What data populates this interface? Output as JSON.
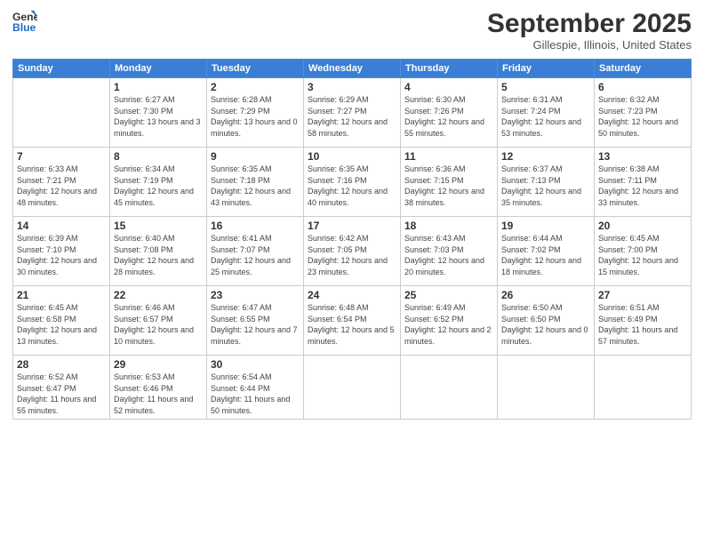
{
  "logo": {
    "line1": "General",
    "line2": "Blue"
  },
  "title": "September 2025",
  "subtitle": "Gillespie, Illinois, United States",
  "weekdays": [
    "Sunday",
    "Monday",
    "Tuesday",
    "Wednesday",
    "Thursday",
    "Friday",
    "Saturday"
  ],
  "weeks": [
    [
      {
        "day": "",
        "sunrise": "",
        "sunset": "",
        "daylight": ""
      },
      {
        "day": "1",
        "sunrise": "Sunrise: 6:27 AM",
        "sunset": "Sunset: 7:30 PM",
        "daylight": "Daylight: 13 hours and 3 minutes."
      },
      {
        "day": "2",
        "sunrise": "Sunrise: 6:28 AM",
        "sunset": "Sunset: 7:29 PM",
        "daylight": "Daylight: 13 hours and 0 minutes."
      },
      {
        "day": "3",
        "sunrise": "Sunrise: 6:29 AM",
        "sunset": "Sunset: 7:27 PM",
        "daylight": "Daylight: 12 hours and 58 minutes."
      },
      {
        "day": "4",
        "sunrise": "Sunrise: 6:30 AM",
        "sunset": "Sunset: 7:26 PM",
        "daylight": "Daylight: 12 hours and 55 minutes."
      },
      {
        "day": "5",
        "sunrise": "Sunrise: 6:31 AM",
        "sunset": "Sunset: 7:24 PM",
        "daylight": "Daylight: 12 hours and 53 minutes."
      },
      {
        "day": "6",
        "sunrise": "Sunrise: 6:32 AM",
        "sunset": "Sunset: 7:23 PM",
        "daylight": "Daylight: 12 hours and 50 minutes."
      }
    ],
    [
      {
        "day": "7",
        "sunrise": "Sunrise: 6:33 AM",
        "sunset": "Sunset: 7:21 PM",
        "daylight": "Daylight: 12 hours and 48 minutes."
      },
      {
        "day": "8",
        "sunrise": "Sunrise: 6:34 AM",
        "sunset": "Sunset: 7:19 PM",
        "daylight": "Daylight: 12 hours and 45 minutes."
      },
      {
        "day": "9",
        "sunrise": "Sunrise: 6:35 AM",
        "sunset": "Sunset: 7:18 PM",
        "daylight": "Daylight: 12 hours and 43 minutes."
      },
      {
        "day": "10",
        "sunrise": "Sunrise: 6:35 AM",
        "sunset": "Sunset: 7:16 PM",
        "daylight": "Daylight: 12 hours and 40 minutes."
      },
      {
        "day": "11",
        "sunrise": "Sunrise: 6:36 AM",
        "sunset": "Sunset: 7:15 PM",
        "daylight": "Daylight: 12 hours and 38 minutes."
      },
      {
        "day": "12",
        "sunrise": "Sunrise: 6:37 AM",
        "sunset": "Sunset: 7:13 PM",
        "daylight": "Daylight: 12 hours and 35 minutes."
      },
      {
        "day": "13",
        "sunrise": "Sunrise: 6:38 AM",
        "sunset": "Sunset: 7:11 PM",
        "daylight": "Daylight: 12 hours and 33 minutes."
      }
    ],
    [
      {
        "day": "14",
        "sunrise": "Sunrise: 6:39 AM",
        "sunset": "Sunset: 7:10 PM",
        "daylight": "Daylight: 12 hours and 30 minutes."
      },
      {
        "day": "15",
        "sunrise": "Sunrise: 6:40 AM",
        "sunset": "Sunset: 7:08 PM",
        "daylight": "Daylight: 12 hours and 28 minutes."
      },
      {
        "day": "16",
        "sunrise": "Sunrise: 6:41 AM",
        "sunset": "Sunset: 7:07 PM",
        "daylight": "Daylight: 12 hours and 25 minutes."
      },
      {
        "day": "17",
        "sunrise": "Sunrise: 6:42 AM",
        "sunset": "Sunset: 7:05 PM",
        "daylight": "Daylight: 12 hours and 23 minutes."
      },
      {
        "day": "18",
        "sunrise": "Sunrise: 6:43 AM",
        "sunset": "Sunset: 7:03 PM",
        "daylight": "Daylight: 12 hours and 20 minutes."
      },
      {
        "day": "19",
        "sunrise": "Sunrise: 6:44 AM",
        "sunset": "Sunset: 7:02 PM",
        "daylight": "Daylight: 12 hours and 18 minutes."
      },
      {
        "day": "20",
        "sunrise": "Sunrise: 6:45 AM",
        "sunset": "Sunset: 7:00 PM",
        "daylight": "Daylight: 12 hours and 15 minutes."
      }
    ],
    [
      {
        "day": "21",
        "sunrise": "Sunrise: 6:45 AM",
        "sunset": "Sunset: 6:58 PM",
        "daylight": "Daylight: 12 hours and 13 minutes."
      },
      {
        "day": "22",
        "sunrise": "Sunrise: 6:46 AM",
        "sunset": "Sunset: 6:57 PM",
        "daylight": "Daylight: 12 hours and 10 minutes."
      },
      {
        "day": "23",
        "sunrise": "Sunrise: 6:47 AM",
        "sunset": "Sunset: 6:55 PM",
        "daylight": "Daylight: 12 hours and 7 minutes."
      },
      {
        "day": "24",
        "sunrise": "Sunrise: 6:48 AM",
        "sunset": "Sunset: 6:54 PM",
        "daylight": "Daylight: 12 hours and 5 minutes."
      },
      {
        "day": "25",
        "sunrise": "Sunrise: 6:49 AM",
        "sunset": "Sunset: 6:52 PM",
        "daylight": "Daylight: 12 hours and 2 minutes."
      },
      {
        "day": "26",
        "sunrise": "Sunrise: 6:50 AM",
        "sunset": "Sunset: 6:50 PM",
        "daylight": "Daylight: 12 hours and 0 minutes."
      },
      {
        "day": "27",
        "sunrise": "Sunrise: 6:51 AM",
        "sunset": "Sunset: 6:49 PM",
        "daylight": "Daylight: 11 hours and 57 minutes."
      }
    ],
    [
      {
        "day": "28",
        "sunrise": "Sunrise: 6:52 AM",
        "sunset": "Sunset: 6:47 PM",
        "daylight": "Daylight: 11 hours and 55 minutes."
      },
      {
        "day": "29",
        "sunrise": "Sunrise: 6:53 AM",
        "sunset": "Sunset: 6:46 PM",
        "daylight": "Daylight: 11 hours and 52 minutes."
      },
      {
        "day": "30",
        "sunrise": "Sunrise: 6:54 AM",
        "sunset": "Sunset: 6:44 PM",
        "daylight": "Daylight: 11 hours and 50 minutes."
      },
      {
        "day": "",
        "sunrise": "",
        "sunset": "",
        "daylight": ""
      },
      {
        "day": "",
        "sunrise": "",
        "sunset": "",
        "daylight": ""
      },
      {
        "day": "",
        "sunrise": "",
        "sunset": "",
        "daylight": ""
      },
      {
        "day": "",
        "sunrise": "",
        "sunset": "",
        "daylight": ""
      }
    ]
  ]
}
